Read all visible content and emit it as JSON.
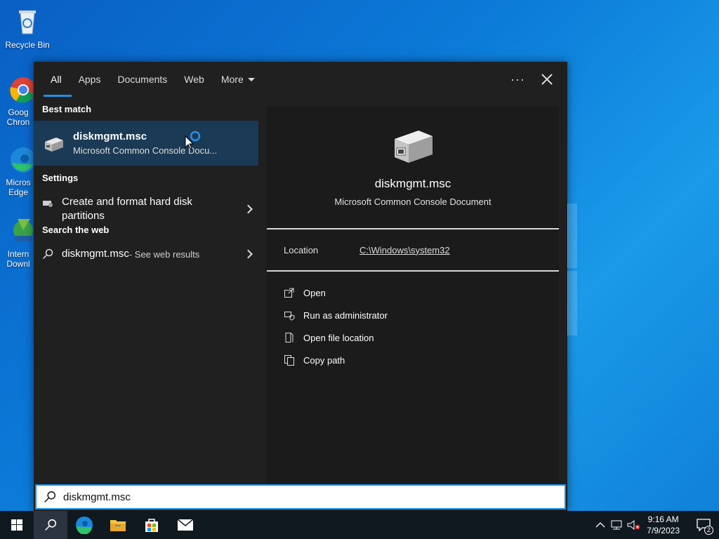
{
  "desktop": {
    "icons": [
      {
        "label": "Recycle Bin"
      },
      {
        "label": "Goog Chron"
      },
      {
        "label": "Micros Edge"
      },
      {
        "label": "Intern Downl"
      }
    ]
  },
  "search_panel": {
    "tabs": [
      {
        "label": "All",
        "active": true
      },
      {
        "label": "Apps"
      },
      {
        "label": "Documents"
      },
      {
        "label": "Web"
      },
      {
        "label": "More"
      }
    ],
    "more_options_label": "···",
    "best_match": {
      "heading": "Best match",
      "title": "diskmgmt.msc",
      "subtitle": "Microsoft Common Console Docu..."
    },
    "settings": {
      "heading": "Settings",
      "item_label": "Create and format hard disk partitions"
    },
    "web": {
      "heading": "Search the web",
      "query": "diskmgmt.msc",
      "suffix": " - See web results"
    },
    "preview": {
      "title": "diskmgmt.msc",
      "subtitle": "Microsoft Common Console Document",
      "location_label": "Location",
      "location_value": "C:\\Windows\\system32",
      "actions": [
        {
          "label": "Open",
          "icon": "open-icon"
        },
        {
          "label": "Run as administrator",
          "icon": "shield-icon"
        },
        {
          "label": "Open file location",
          "icon": "folder-location-icon"
        },
        {
          "label": "Copy path",
          "icon": "copy-icon"
        }
      ]
    },
    "search_input_value": "diskmgmt.msc"
  },
  "taskbar": {
    "time": "9:16 AM",
    "date": "7/9/2023",
    "notification_count": "2",
    "accent": "#1f8fe0"
  }
}
